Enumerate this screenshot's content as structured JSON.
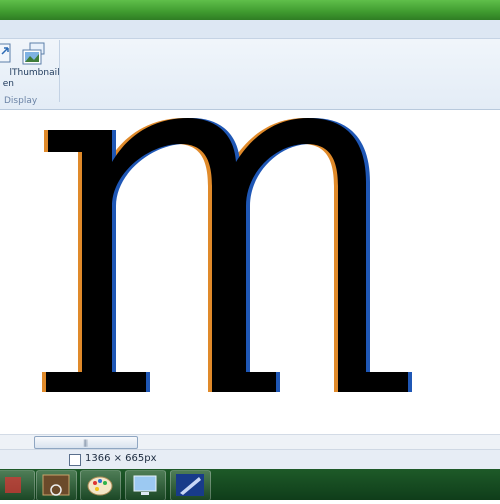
{
  "ribbon": {
    "buttons": [
      {
        "label_lines": [
          "l",
          "en"
        ]
      },
      {
        "label_lines": [
          "Thumbnail"
        ]
      }
    ],
    "group_label": "Display"
  },
  "canvas": {
    "glyph": "m"
  },
  "status": {
    "dimensions": "1366 × 665px"
  },
  "colors": {
    "titlebar": "#3f9a2f",
    "ribbon_bg": "#e9f0f8",
    "taskbar": "#14471f"
  },
  "taskbar": {
    "items": [
      "media-player-icon",
      "paint-icon",
      "remote-desktop-icon",
      "media-center-icon"
    ]
  }
}
